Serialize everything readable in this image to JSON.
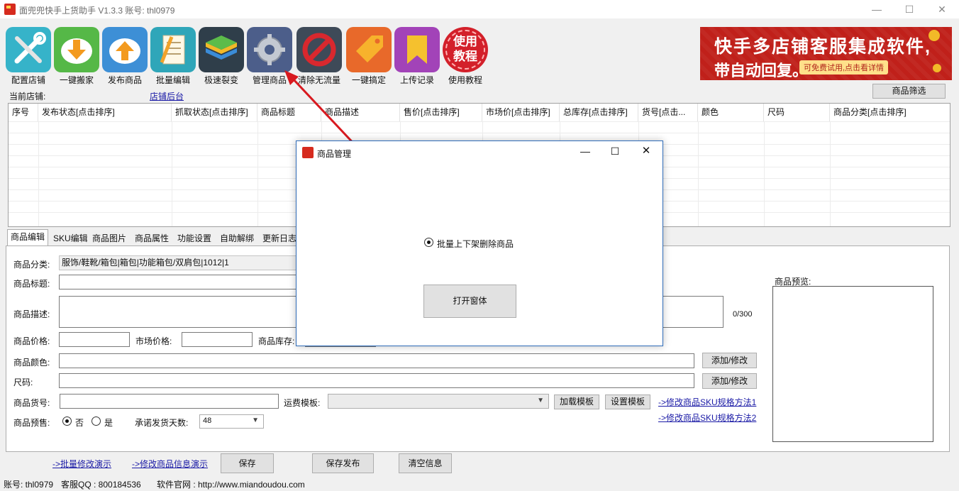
{
  "window": {
    "title": "面兜兜快手上货助手 V1.3.3   账号: thl0979",
    "minimize": "—",
    "maximize": "☐",
    "close": "✕"
  },
  "toolbar": [
    {
      "label": "配置店铺",
      "icon": "tools-icon",
      "color": "#36b3c9"
    },
    {
      "label": "一键搬家",
      "icon": "download-cloud-icon",
      "color": "#55b847"
    },
    {
      "label": "发布商品",
      "icon": "upload-cloud-icon",
      "color": "#3d8fd6"
    },
    {
      "label": "批量编辑",
      "icon": "edit-document-icon",
      "color": "#2fa6b9"
    },
    {
      "label": "极速裂变",
      "icon": "layers-icon",
      "color": "#2f3e4a"
    },
    {
      "label": "管理商品",
      "icon": "gear-icon",
      "color": "#4c5e8a"
    },
    {
      "label": "清除无流量",
      "icon": "forbidden-icon",
      "color": "#3e4a58"
    },
    {
      "label": "一键搞定",
      "icon": "tag-icon",
      "color": "#e8692a"
    },
    {
      "label": "上传记录",
      "icon": "bookmark-icon",
      "color": "#a243b8"
    },
    {
      "label": "使用教程",
      "icon": "tutorial-badge-icon",
      "color": "#d3202a",
      "badge_text": "使用\n教程"
    }
  ],
  "banner": {
    "line1": "快手多店铺客服集成软件,",
    "line2": "带自动回复。",
    "tag": "可免费试用,点击看详情"
  },
  "store": {
    "label": "当前店铺:",
    "backend_link": "店铺后台",
    "filter_button": "商品筛选"
  },
  "grid": {
    "columns": [
      "序号",
      "发布状态[点击排序]",
      "抓取状态[点击排序]",
      "商品标题",
      "商品描述",
      "售价[点击排序]",
      "市场价[点击排序]",
      "总库存[点击排序]",
      "货号[点击...",
      "颜色",
      "尺码",
      "商品分类[点击排序]"
    ]
  },
  "tabs": [
    "商品编辑",
    "SKU编辑",
    "商品图片",
    "商品属性",
    "功能设置",
    "自助解绑",
    "更新日志"
  ],
  "form": {
    "category_label": "商品分类:",
    "category_value": "服饰/鞋靴/箱包|箱包|功能箱包/双肩包|1012|1",
    "title_label": "商品标题:",
    "desc_label": "商品描述:",
    "desc_counter": "0/300",
    "price_label": "商品价格:",
    "market_price_label": "市场价格:",
    "stock_label": "商品库存:",
    "color_label": "商品颜色:",
    "size_label": "尺码:",
    "add_modify_1": "添加/修改",
    "add_modify_2": "添加/修改",
    "sku_no_label": "商品货号:",
    "shipping_template_label": "运费模板:",
    "load_template": "加载模板",
    "set_template": "设置模板",
    "sku_method_1": "->修改商品SKU规格方法1",
    "sku_method_2": "->修改商品SKU规格方法2",
    "presale_label": "商品预售:",
    "presale_no": "否",
    "presale_yes": "是",
    "ship_days_label": "承诺发货天数:",
    "ship_days_value": "48",
    "preview_label": "商品预览:"
  },
  "bottom": {
    "batch_demo": "->批量修改演示",
    "modify_demo": "->修改商品信息演示",
    "save": "保存",
    "save_publish": "保存发布",
    "clear": "清空信息"
  },
  "status": {
    "account": "账号: thl0979",
    "qq": "客服QQ : 800184536",
    "site": "软件官网 : http://www.miandoudou.com"
  },
  "dialog": {
    "title": "商品管理",
    "radio_label": "批量上下架删除商品",
    "open_button": "打开窗体"
  }
}
